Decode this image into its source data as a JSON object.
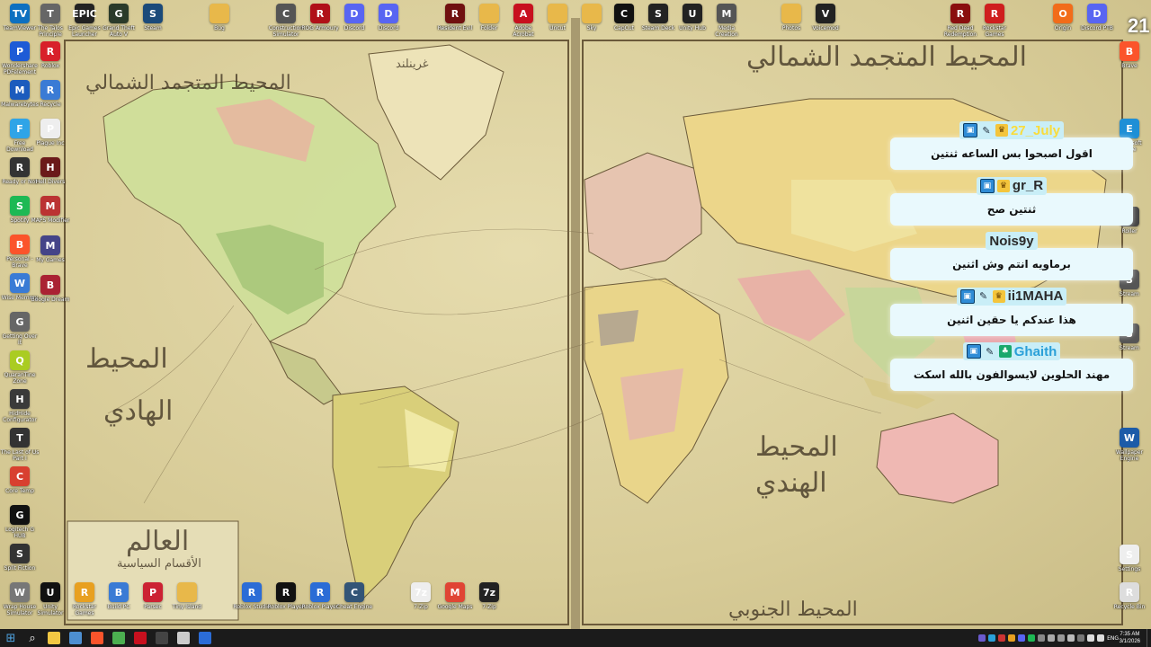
{
  "wallpaper": {
    "labels": {
      "north_atlantic_left": "المحيط المتجمد الشمالي",
      "north_atlantic_right": "المحيط المتجمد الشمالي",
      "greenland": "غرينلند",
      "pacific_1": "المحيط",
      "pacific_2": "الهادي",
      "indian_1": "المحيط",
      "indian_2": "الهندي",
      "southern": "المحيط الجنوبي",
      "title_main": "العالم",
      "title_sub": "الأقسام السياسية"
    }
  },
  "corner_number": "21",
  "desktop": {
    "top_row": [
      {
        "label": "TeamViewer",
        "icon": "teamviewer-icon",
        "color": "#0e70c0",
        "glyph": "TV"
      },
      {
        "label": "The Talos Principle",
        "icon": "talos-icon",
        "color": "#666666",
        "glyph": "T"
      },
      {
        "label": "Epic Games Launcher",
        "icon": "epic-icon",
        "color": "#222222",
        "glyph": "EPIC"
      },
      {
        "label": "Grand Theft Auto V",
        "icon": "gta-icon",
        "color": "#2a3a2a",
        "glyph": "G"
      },
      {
        "label": "Steam",
        "icon": "steam-icon",
        "color": "#1b4a7a",
        "glyph": "S"
      },
      {
        "label": "Bug",
        "icon": "folder-icon",
        "color": "#e8b84a",
        "glyph": ""
      },
      {
        "label": "Construction Simulator",
        "icon": "construction-icon",
        "color": "#555555",
        "glyph": "C"
      },
      {
        "label": "ROG Armoury",
        "icon": "rog-icon",
        "color": "#b01018",
        "glyph": "R"
      },
      {
        "label": "Discord",
        "icon": "discord-icon",
        "color": "#5865f2",
        "glyph": "D"
      },
      {
        "label": "Discord",
        "icon": "discord-icon",
        "color": "#5865f2",
        "glyph": "D"
      },
      {
        "label": "Resident Evil",
        "icon": "re-icon",
        "color": "#701010",
        "glyph": "R"
      },
      {
        "label": "Folder",
        "icon": "folder-icon",
        "color": "#e8b84a",
        "glyph": ""
      },
      {
        "label": "Adobe Acrobat",
        "icon": "acrobat-icon",
        "color": "#c8101e",
        "glyph": "A"
      },
      {
        "label": "Uncut",
        "icon": "folder-icon",
        "color": "#e8b84a",
        "glyph": ""
      },
      {
        "label": "Sky",
        "icon": "folder-icon",
        "color": "#e8b84a",
        "glyph": ""
      },
      {
        "label": "CapCut",
        "icon": "capcut-icon",
        "color": "#111111",
        "glyph": "C"
      },
      {
        "label": "Steam Deck",
        "icon": "steamdeck-icon",
        "color": "#222222",
        "glyph": "S"
      },
      {
        "label": "Unity Hub",
        "icon": "unity-icon",
        "color": "#222222",
        "glyph": "U"
      },
      {
        "label": "Media Creation",
        "icon": "media-icon",
        "color": "#555555",
        "glyph": "M"
      },
      {
        "label": "Photos",
        "icon": "folder-icon",
        "color": "#e8b84a",
        "glyph": ""
      },
      {
        "label": "Voicemod",
        "icon": "voicemod-icon",
        "color": "#222222",
        "glyph": "V"
      },
      {
        "label": "Red Dead Redemption",
        "icon": "rdr-icon",
        "color": "#8a0e0e",
        "glyph": "R"
      },
      {
        "label": "Rockstar Games",
        "icon": "rockstar-icon",
        "color": "#cf1e1e",
        "glyph": "R"
      },
      {
        "label": "Origin",
        "icon": "origin-icon",
        "color": "#f26c1a",
        "glyph": "O"
      },
      {
        "label": "Discord PTB",
        "icon": "discord-icon",
        "color": "#5865f2",
        "glyph": "D"
      }
    ],
    "left_col": [
      {
        "label": "Wondershare PDFelement",
        "icon": "pdfelement-icon",
        "color": "#1d5bd6",
        "glyph": "P"
      },
      {
        "label": "Malwarebytes",
        "icon": "malwarebytes-icon",
        "color": "#1b5bbd",
        "glyph": "M"
      },
      {
        "label": "Free Download Manager",
        "icon": "fdm-icon",
        "color": "#2fa4e7",
        "glyph": "F"
      },
      {
        "label": "Ready or Not",
        "icon": "readyornot-icon",
        "color": "#333333",
        "glyph": "R"
      },
      {
        "label": "Spotify",
        "icon": "spotify-icon",
        "color": "#1db954",
        "glyph": "S"
      },
      {
        "label": "Personal - Brave",
        "icon": "brave-icon",
        "color": "#fb542b",
        "glyph": "B"
      },
      {
        "label": "Wise Memory",
        "icon": "wise-icon",
        "color": "#3a7bd5",
        "glyph": "W"
      },
      {
        "label": "Getting Over It",
        "icon": "gettingover-icon",
        "color": "#666666",
        "glyph": "G"
      },
      {
        "label": "QuaranTine Zone",
        "icon": "quarantine-icon",
        "color": "#aacc22",
        "glyph": "Q"
      },
      {
        "label": "HidHide Configurator",
        "icon": "hidhide-icon",
        "color": "#3a3a3a",
        "glyph": "H"
      },
      {
        "label": "The Last of Us Part I",
        "icon": "tlou-icon",
        "color": "#333333",
        "glyph": "T"
      },
      {
        "label": "Core Temp",
        "icon": "coretemp-icon",
        "color": "#d84030",
        "glyph": "C"
      },
      {
        "label": "Logitech G HUB",
        "icon": "ghub-icon",
        "color": "#111111",
        "glyph": "G"
      },
      {
        "label": "Split Fiction",
        "icon": "splitfiction-icon",
        "color": "#333333",
        "glyph": "S"
      },
      {
        "label": "Wrap House Simulator",
        "icon": "wraphouse-icon",
        "color": "#777777",
        "glyph": "W"
      }
    ],
    "second_col": [
      {
        "label": "Roblox",
        "icon": "roblox-icon",
        "color": "#d8202a",
        "glyph": "R"
      },
      {
        "label": "Recycle",
        "icon": "recycle-icon",
        "color": "#3a7bd5",
        "glyph": "R"
      },
      {
        "label": "Plague Inc",
        "icon": "plague-icon",
        "color": "#eeeeee",
        "glyph": "P"
      },
      {
        "label": "Hell Divers",
        "icon": "helldivers-icon",
        "color": "#6b1a1a",
        "glyph": "H"
      },
      {
        "label": "MAPS Modifier",
        "icon": "maps-icon",
        "color": "#b33",
        "glyph": "M"
      },
      {
        "label": "My Games",
        "icon": "mygames-icon",
        "color": "#444488",
        "glyph": "M"
      },
      {
        "label": "Boogie Dream",
        "icon": "boogie-icon",
        "color": "#aa2233",
        "glyph": "B"
      }
    ],
    "bottom_row": [
      {
        "label": "Unity Simulator",
        "icon": "unity-icon",
        "color": "#111111",
        "glyph": "U"
      },
      {
        "label": "Rockstar Games Launcher",
        "icon": "rockstar-icon",
        "color": "#e8a020",
        "glyph": "R"
      },
      {
        "label": "Build PC",
        "icon": "buildpc-icon",
        "color": "#3a7bd5",
        "glyph": "B"
      },
      {
        "label": "Parsec",
        "icon": "parsec-icon",
        "color": "#cc2233",
        "glyph": "P"
      },
      {
        "label": "Tiny Island",
        "icon": "folder-icon",
        "color": "#e8b84a",
        "glyph": ""
      },
      {
        "label": "Roblox Studio",
        "icon": "robloxstudio-icon",
        "color": "#2b6cd6",
        "glyph": "R"
      },
      {
        "label": "Roblox Player",
        "icon": "roblox-icon",
        "color": "#111111",
        "glyph": "R"
      },
      {
        "label": "Roblox Player",
        "icon": "roblox-icon",
        "color": "#2b6cd6",
        "glyph": "R"
      },
      {
        "label": "Cheat Engine",
        "icon": "cheatengine-icon",
        "color": "#335577",
        "glyph": "C"
      },
      {
        "label": "7-Zip",
        "icon": "sevenzip-icon",
        "color": "#eeeeee",
        "glyph": "7z"
      },
      {
        "label": "Google Maps",
        "icon": "maps-icon",
        "color": "#e04434",
        "glyph": "M"
      },
      {
        "label": "7-Zip",
        "icon": "sevenzip-icon",
        "color": "#222222",
        "glyph": "7z"
      }
    ],
    "right_col": [
      {
        "label": "Brave",
        "icon": "brave-icon",
        "color": "#fb542b",
        "glyph": "B"
      },
      {
        "label": "Microsoft Edge",
        "icon": "edge-icon",
        "color": "#1e8fd6",
        "glyph": "E"
      },
      {
        "label": "Roller",
        "icon": "roller-icon",
        "color": "#444444",
        "glyph": "R"
      },
      {
        "label": "Stream",
        "icon": "stream-icon",
        "color": "#555555",
        "glyph": "S"
      },
      {
        "label": "Stream",
        "icon": "stream-icon",
        "color": "#555555",
        "glyph": "S"
      },
      {
        "label": "Wallpaper Engine",
        "icon": "wallpaper-icon",
        "color": "#1c5ba8",
        "glyph": "W"
      },
      {
        "label": "Settings",
        "icon": "settings-icon",
        "color": "#eeeeee",
        "glyph": "S"
      },
      {
        "label": "Recycle Bin",
        "icon": "recycle-bin-icon",
        "color": "#dddddd",
        "glyph": "R"
      }
    ]
  },
  "chat": [
    {
      "name": "27_July",
      "name_color": "#f9dc3c",
      "badges": [
        "crown-icon",
        "pen-icon",
        "prime-icon"
      ],
      "text": "اقول اصبحوا بس الساعه ثنتين"
    },
    {
      "name": "gr_R",
      "name_color": "#2a2a2a",
      "badges": [
        "crown-icon",
        "prime-icon"
      ],
      "text": "ثنتين صح"
    },
    {
      "name": "Nois9y",
      "name_color": "#2a2a2a",
      "badges": [],
      "text": "برماويه انتم وش اثنين"
    },
    {
      "name": "ii1MAHA",
      "name_color": "#2a2a2a",
      "badges": [
        "crown-icon",
        "pen-icon",
        "prime-icon"
      ],
      "text": "هذا عندكم يا حقين اثنين"
    },
    {
      "name": "Ghaith",
      "name_color": "#2aa0d8",
      "badges": [
        "gift-icon",
        "pen-icon",
        "prime-icon"
      ],
      "text": "مهند الحلوين لايسوالفون بالله اسكت"
    }
  ],
  "taskbar": {
    "clock_time": "7:35 AM",
    "clock_date": "3/1/2026",
    "language": "ENG",
    "apps": [
      {
        "name": "windows-start-icon",
        "color": "#4fa3e0"
      },
      {
        "name": "search-icon",
        "color": "#ffffff"
      },
      {
        "name": "file-explorer-icon",
        "color": "#f3c843"
      },
      {
        "name": "steam-taskbar-icon",
        "color": "#4d8fd1"
      },
      {
        "name": "brave-taskbar-icon",
        "color": "#fb542b"
      },
      {
        "name": "chrome-taskbar-icon",
        "color": "#4caf50"
      },
      {
        "name": "acrobat-taskbar-icon",
        "color": "#c8101e"
      },
      {
        "name": "obs-taskbar-icon",
        "color": "#444444"
      },
      {
        "name": "settings-taskbar-icon",
        "color": "#cccccc"
      },
      {
        "name": "roblox-studio-taskbar-icon",
        "color": "#2b6cd6"
      }
    ]
  }
}
